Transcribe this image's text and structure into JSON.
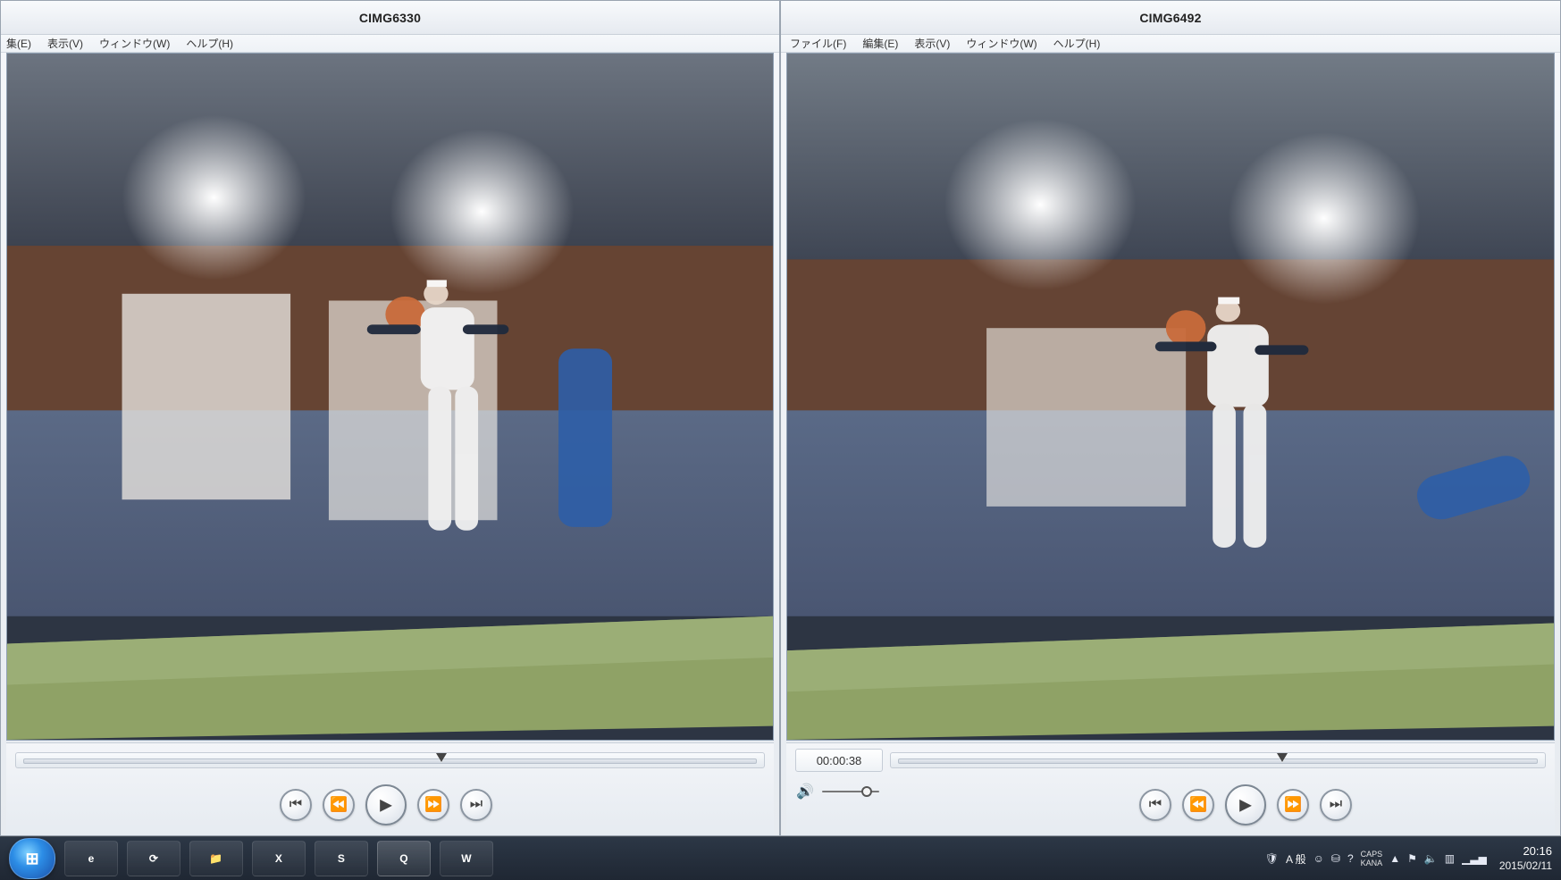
{
  "left_window": {
    "title": "CIMG6330",
    "menu": [
      "集(E)",
      "表示(V)",
      "ウィンドウ(W)",
      "ヘルプ(H)"
    ],
    "controls": {
      "timeline_marker_fraction": 0.57,
      "transport": [
        {
          "name": "jump-start-button",
          "glyph": "⏮"
        },
        {
          "name": "rewind-button",
          "glyph": "⏪"
        },
        {
          "name": "play-button",
          "glyph": "▶"
        },
        {
          "name": "fast-forward-button",
          "glyph": "⏩"
        },
        {
          "name": "jump-end-button",
          "glyph": "⏭"
        }
      ]
    }
  },
  "right_window": {
    "title": "CIMG6492",
    "menu": [
      "ファイル(F)",
      "編集(E)",
      "表示(V)",
      "ウィンドウ(W)",
      "ヘルプ(H)"
    ],
    "controls": {
      "timecode": "00:00:38",
      "timeline_marker_fraction": 0.6,
      "volume_fraction": 0.78,
      "transport": [
        {
          "name": "jump-start-button",
          "glyph": "⏮"
        },
        {
          "name": "rewind-button",
          "glyph": "⏪"
        },
        {
          "name": "play-button",
          "glyph": "▶"
        },
        {
          "name": "fast-forward-button",
          "glyph": "⏩"
        },
        {
          "name": "jump-end-button",
          "glyph": "⏭"
        }
      ]
    }
  },
  "taskbar": {
    "apps": [
      {
        "name": "internet-explorer",
        "label": "e"
      },
      {
        "name": "app-2",
        "label": "⟳"
      },
      {
        "name": "file-explorer",
        "label": "📁"
      },
      {
        "name": "excel",
        "label": "X"
      },
      {
        "name": "skype",
        "label": "S"
      },
      {
        "name": "quicktime",
        "label": "Q"
      },
      {
        "name": "word",
        "label": "W"
      }
    ],
    "tray": {
      "ime_label": "A 般",
      "caps": [
        "CAPS",
        "KANA"
      ],
      "time": "20:16",
      "date": "2015/02/11"
    }
  }
}
